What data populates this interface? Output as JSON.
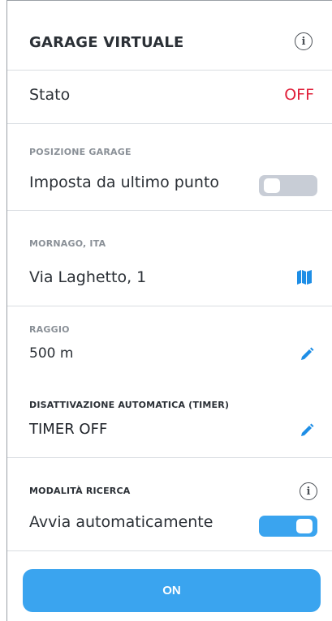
{
  "header": {
    "title": "GARAGE VIRTUALE",
    "info_icon": "info-icon"
  },
  "status": {
    "label": "Stato",
    "value": "OFF",
    "value_color": "#e0203a"
  },
  "garage_position": {
    "section_label": "POSIZIONE GARAGE",
    "toggle_label": "Imposta da ultimo punto",
    "toggle_state": "off"
  },
  "address": {
    "city_label": "MORNAGO, ITA",
    "street": "Via Laghetto, 1",
    "map_icon": "map-icon"
  },
  "radius": {
    "label": "RAGGIO",
    "value": "500 m",
    "edit_icon": "pencil-icon"
  },
  "timer": {
    "label": "DISATTIVAZIONE AUTOMATICA (TIMER)",
    "value": "TIMER OFF",
    "edit_icon": "pencil-icon"
  },
  "search_mode": {
    "label": "MODALITÀ RICERCA",
    "toggle_label": "Avvia automaticamente",
    "toggle_state": "on",
    "info_icon": "info-icon"
  },
  "action": {
    "button_label": "ON"
  },
  "colors": {
    "accent": "#3aa4ef",
    "off_red": "#e0203a",
    "toggle_off": "#c8cdd6"
  }
}
